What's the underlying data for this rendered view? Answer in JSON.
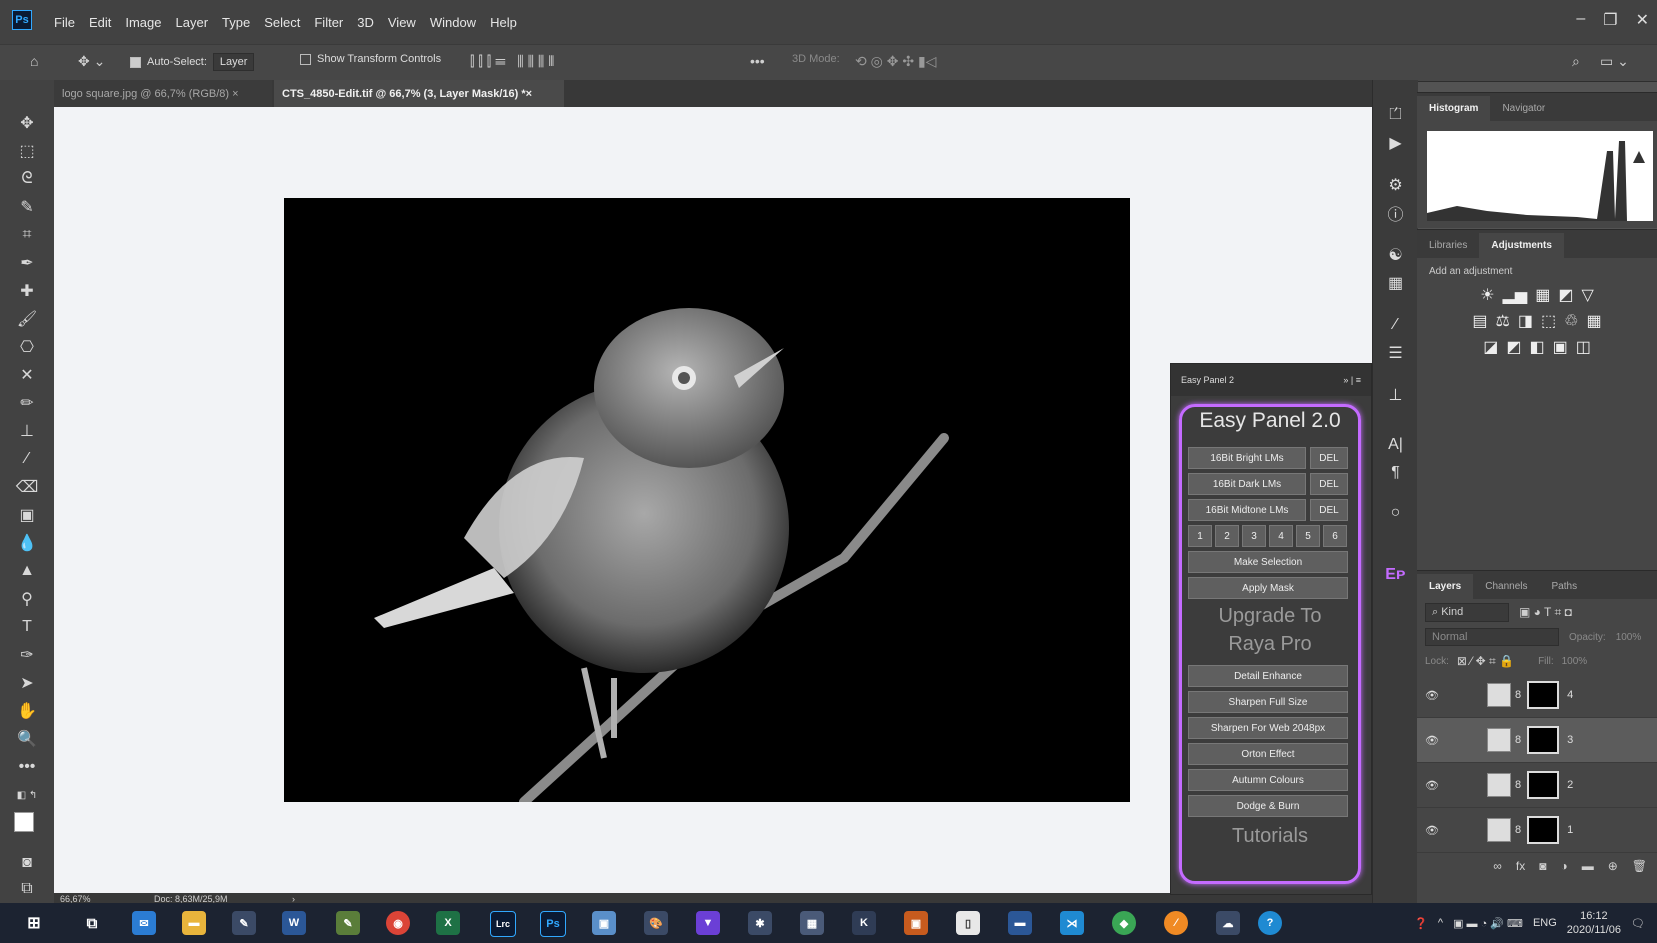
{
  "menu": {
    "app_logo": "Ps",
    "items": [
      "File",
      "Edit",
      "Image",
      "Layer",
      "Type",
      "Select",
      "Filter",
      "3D",
      "View",
      "Window",
      "Help"
    ]
  },
  "options": {
    "auto_select_label": "Auto-Select:",
    "auto_select_value": "Layer",
    "show_transform_label": "Show Transform Controls",
    "mode_3d_label": "3D Mode:"
  },
  "tabs": [
    {
      "label": "logo square.jpg @ 66,7% (RGB/8)",
      "close": "×"
    },
    {
      "label": "CTS_4850-Edit.tif @ 66,7% (3, Layer Mask/16) *",
      "close": "×"
    }
  ],
  "status": {
    "zoom": "66,67%",
    "doc": "Doc: 8,63M/25,9M"
  },
  "histogram_panel": {
    "tabs": [
      "Histogram",
      "Navigator"
    ]
  },
  "adjust_panel": {
    "tabs": [
      "Libraries",
      "Adjustments"
    ],
    "label": "Add an adjustment"
  },
  "layers_panel": {
    "tabs": [
      "Layers",
      "Channels",
      "Paths"
    ],
    "kind": "Kind",
    "blend": "Normal",
    "opacity_label": "Opacity:",
    "opacity_value": "100%",
    "lock_label": "Lock:",
    "fill_label": "Fill:",
    "fill_value": "100%",
    "layers": [
      {
        "name": "4",
        "selected": false
      },
      {
        "name": "3",
        "selected": true
      },
      {
        "name": "2",
        "selected": false
      },
      {
        "name": "1",
        "selected": false
      }
    ]
  },
  "easy_panel": {
    "header": "Easy Panel 2",
    "title": "Easy Panel 2.0",
    "bright": "16Bit Bright LMs",
    "dark": "16Bit Dark LMs",
    "mid": "16Bit Midtone LMs",
    "del": "DEL",
    "nums": [
      "1",
      "2",
      "3",
      "4",
      "5",
      "6"
    ],
    "make_selection": "Make Selection",
    "apply_mask": "Apply Mask",
    "upgrade_1": "Upgrade To",
    "upgrade_2": "Raya Pro",
    "detail": "Detail Enhance",
    "sharpen_full": "Sharpen Full Size",
    "sharpen_web": "Sharpen For Web 2048px",
    "orton": "Orton Effect",
    "autumn": "Autumn Colours",
    "dodge": "Dodge & Burn",
    "tutorials": "Tutorials"
  },
  "taskbar": {
    "apps": [
      "Lrc",
      "Ps"
    ],
    "lang": "ENG",
    "time": "16:12",
    "date": "2020/11/06"
  }
}
